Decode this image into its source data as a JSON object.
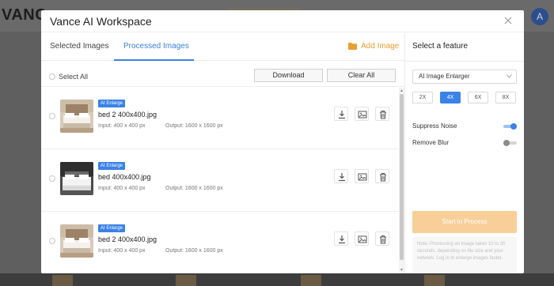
{
  "background": {
    "logo": "VANC",
    "avatar_initial": "A"
  },
  "modal": {
    "title": "Vance AI Workspace"
  },
  "tabs": {
    "selected": "Selected Images",
    "processed": "Processed Images",
    "active": "processed",
    "add_image": "Add Image"
  },
  "toolbar": {
    "select_all": "Select All",
    "download": "Download",
    "clear_all": "Clear All"
  },
  "images": [
    {
      "badge": "AI Enlarge",
      "filename": "bed 2 400x400.jpg",
      "input": "Input:  400 x 400 px",
      "output": "Output:  1600 x 1600 px",
      "thumb": "bed-light"
    },
    {
      "badge": "AI Enlarge",
      "filename": "bed 400x400.jpg",
      "input": "Input:  400 x 400 px",
      "output": "Output:  1600 x 1600 px",
      "thumb": "bed-dark"
    },
    {
      "badge": "AI Enlarge",
      "filename": "bed 2 400x400.jpg",
      "input": "Input:  400 x 400 px",
      "output": "Output:  1600 x 1600 px",
      "thumb": "bed-light"
    }
  ],
  "feature": {
    "title": "Select a feature",
    "selected_feature": "AI Image Enlarger",
    "scales": [
      "2X",
      "4X",
      "6X",
      "8X"
    ],
    "selected_scale": "4X",
    "suppress_noise_label": "Suppress Noise",
    "suppress_noise_on": true,
    "remove_blur_label": "Remove Blur",
    "remove_blur_on": false,
    "start_button": "Start to Process",
    "note": "Note: Processing an image takes 10 to 30 seconds, depending on file size and your network. Log in to enlarge images faster."
  },
  "colors": {
    "accent": "#3b82e6",
    "add_image": "#e8a030",
    "start_button": "#f8cf98"
  }
}
